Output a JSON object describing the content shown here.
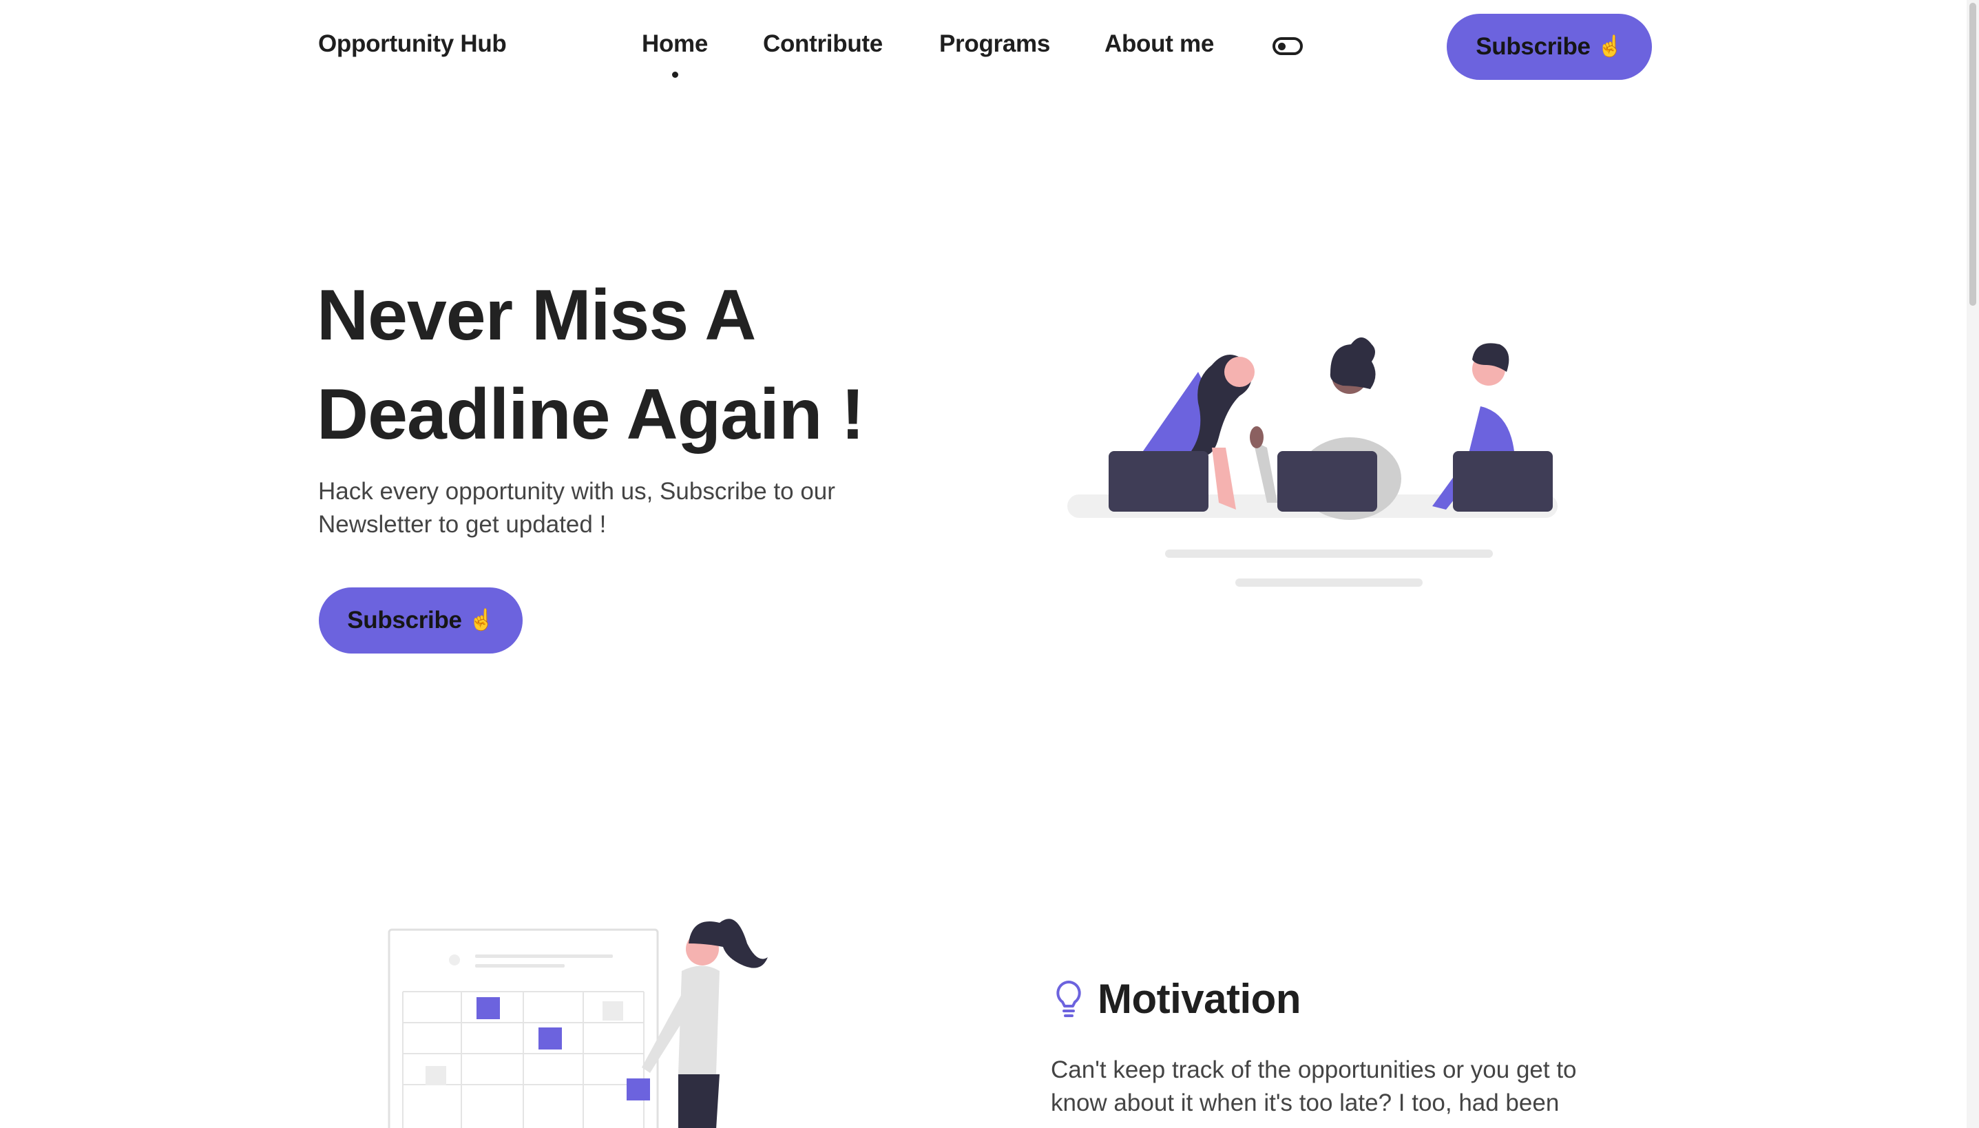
{
  "nav": {
    "brand": "Opportunity Hub",
    "items": [
      {
        "label": "Home",
        "active": true
      },
      {
        "label": "Contribute"
      },
      {
        "label": "Programs"
      },
      {
        "label": "About me"
      }
    ],
    "theme_toggle_icon": "toggle-icon",
    "subscribe_label": "Subscribe",
    "subscribe_icon": "pointing-hand-icon"
  },
  "hero": {
    "title_line1": "Never Miss A",
    "title_line2": "Deadline Again !",
    "subtitle_line1": "Hack every opportunity with us, Subscribe to our",
    "subtitle_line2": "Newsletter to get updated !",
    "subscribe_label": "Subscribe",
    "illustration": "team-with-laptops-illustration"
  },
  "motivation": {
    "icon": "lightbulb-icon",
    "title": "Motivation",
    "text_line1": "Can't keep track of the opportunities or you get to",
    "text_line2": "know about it when it's too late? I too, had been",
    "illustration": "woman-with-calendar-illustration"
  },
  "colors": {
    "accent": "#6c63de",
    "text": "#1f1f1f",
    "muted": "#444444"
  }
}
